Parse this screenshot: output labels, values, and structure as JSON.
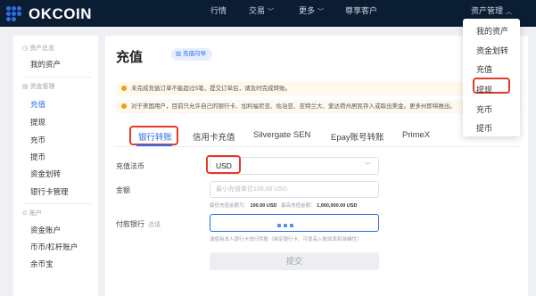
{
  "header": {
    "logo_text": "OKCOIN",
    "nav": [
      {
        "label": "行情"
      },
      {
        "label": "交易"
      },
      {
        "label": "更多"
      },
      {
        "label": "尊享客户"
      }
    ],
    "asset_menu_label": "资产管理"
  },
  "asset_dropdown": {
    "items": [
      "我的资产",
      "资金划转",
      "充值",
      "提现",
      "充币",
      "提币"
    ],
    "selected": "充值"
  },
  "sidebar": {
    "groups": [
      {
        "title": "资产总览",
        "items": [
          "我的资产"
        ]
      },
      {
        "title": "资金管理",
        "items": [
          "充值",
          "提现",
          "充币",
          "提币",
          "资金划转",
          "银行卡管理"
        ]
      },
      {
        "title": "账户",
        "items": [
          "资金账户",
          "币币/杠杆账户",
          "余币宝"
        ]
      }
    ],
    "active": "充值"
  },
  "main": {
    "title": "充值",
    "guide_label": "充值向导",
    "notices": [
      "未完成充值订单不能超过5笔，提交订单后，请及时完成转账。",
      "对于美国用户，目前只允许自己的银行卡、加利福尼亚、佐治亚、亚特兰大、爱达荷州居民存入或取出美金。更多州即将推出。"
    ],
    "tabs": [
      "银行转账",
      "信用卡充值",
      "Silvergate SEN",
      "Epay账号转账",
      "PrimeX"
    ],
    "active_tab": "银行转账",
    "currency_label": "充值法币",
    "currency_value": "USD",
    "amount_label": "金额",
    "amount_placeholder": "最小充值单位100.00 USD",
    "amount_hint": {
      "min_prefix": "最低充值金额为：",
      "min_value": "100.00 USD",
      "max_prefix": "最高充值金额：",
      "max_value": "1,000,000.00 USD"
    },
    "bank_label": "付款银行",
    "bank_optional": "选填",
    "bank_hint": "请使用本人银行卡进行转账（绑定银行卡，可提高入账效率和准确性）",
    "submit_label": "提交"
  },
  "colors": {
    "topbar": "#0b1d33",
    "accent": "#2b6fe8",
    "highlight_box": "#e23b2b",
    "notice_dot": "#f39c12"
  }
}
